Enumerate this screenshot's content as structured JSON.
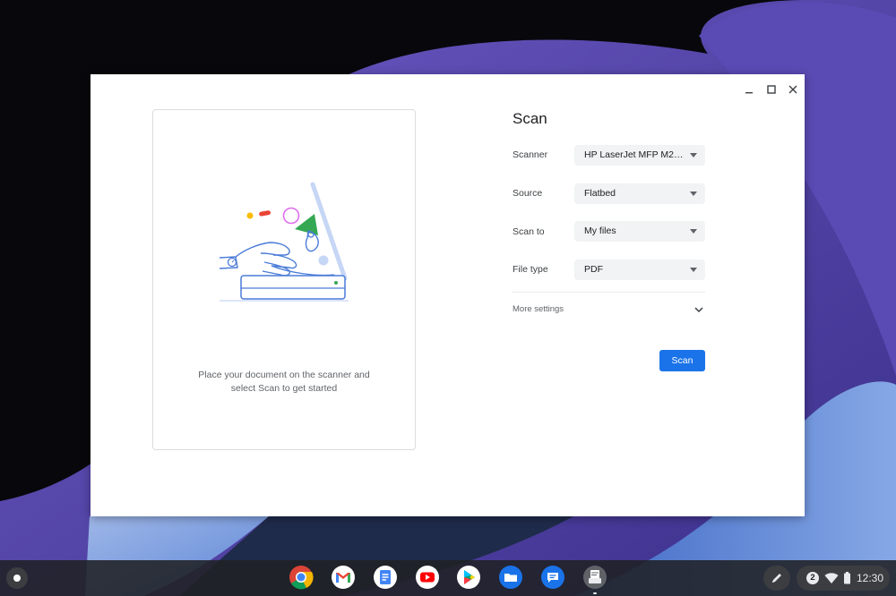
{
  "app": {
    "title": "Scan",
    "window_controls": {
      "minimize": "minimize-icon",
      "maximize": "maximize-icon",
      "close": "close-icon"
    }
  },
  "preview": {
    "illustration": "scanner-illustration",
    "message_line1": "Place your document on the scanner and",
    "message_line2": "select Scan to get started"
  },
  "settings": {
    "scanner": {
      "label": "Scanner",
      "value": "HP LaserJet MFP M29..."
    },
    "source": {
      "label": "Source",
      "value": "Flatbed"
    },
    "scan_to": {
      "label": "Scan to",
      "value": "My files"
    },
    "file_type": {
      "label": "File type",
      "value": "PDF"
    },
    "more_settings": "More settings"
  },
  "actions": {
    "scan_label": "Scan"
  },
  "shelf": {
    "apps": [
      "chrome-icon",
      "gmail-icon",
      "docs-icon",
      "youtube-icon",
      "play-store-icon",
      "files-icon",
      "messages-icon",
      "scan-app-icon"
    ],
    "notification_count": "2",
    "time": "12:30"
  },
  "colors": {
    "accent": "#1a73e8",
    "shelf": "#202124"
  }
}
